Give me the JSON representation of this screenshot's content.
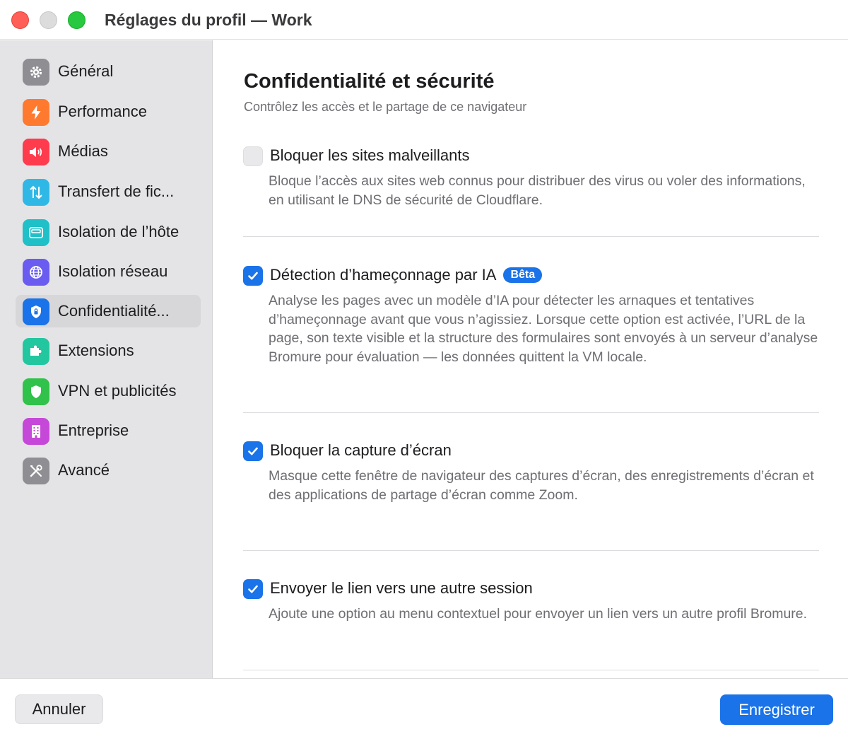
{
  "window": {
    "title": "Réglages du profil — Work"
  },
  "sidebar": {
    "items": [
      {
        "label": "Général",
        "icon": "gear-icon",
        "color": "#8e8e93"
      },
      {
        "label": "Performance",
        "icon": "bolt-icon",
        "color": "#ff7a2f"
      },
      {
        "label": "Médias",
        "icon": "speaker-icon",
        "color": "#ff3b4e"
      },
      {
        "label": "Transfert de fic...",
        "icon": "transfer-arrows-icon",
        "color": "#2fb8e6"
      },
      {
        "label": "Isolation de l’hôte",
        "icon": "window-icon",
        "color": "#20c0c8"
      },
      {
        "label": "Isolation réseau",
        "icon": "globe-icon",
        "color": "#6a5cf0"
      },
      {
        "label": "Confidentialité...",
        "icon": "shield-lock-icon",
        "color": "#1a73e8",
        "selected": true
      },
      {
        "label": "Extensions",
        "icon": "puzzle-icon",
        "color": "#22c7a0"
      },
      {
        "label": "VPN et publicités",
        "icon": "shield-icon",
        "color": "#30c24a"
      },
      {
        "label": "Entreprise",
        "icon": "building-icon",
        "color": "#c648d8"
      },
      {
        "label": "Avancé",
        "icon": "tools-icon",
        "color": "#8e8e93"
      }
    ]
  },
  "main": {
    "title": "Confidentialité et sécurité",
    "subtitle": "Contrôlez les accès et le partage de ce navigateur",
    "options": [
      {
        "title": "Bloquer les sites malveillants",
        "checked": false,
        "description": "Bloque l’accès aux sites web connus pour distribuer des virus ou voler des informations, en utilisant le DNS de sécurité de Cloudflare."
      },
      {
        "title": "Détection d’hameçonnage par IA",
        "checked": true,
        "badge": "Bêta",
        "description": "Analyse les pages avec un modèle d’IA pour détecter les arnaques et tentatives d’hameçonnage avant que vous n’agissiez. Lorsque cette option est activée, l’URL de la page, son texte visible et la structure des formulaires sont envoyés à un serveur d’analyse Bromure pour évaluation — les données quittent la VM locale."
      },
      {
        "title": "Bloquer la capture d’écran",
        "checked": true,
        "description": "Masque cette fenêtre de navigateur des captures d’écran, des enregistrements d’écran et des applications de partage d’écran comme Zoom."
      },
      {
        "title": "Envoyer le lien vers une autre session",
        "checked": true,
        "description": "Ajoute une option au menu contextuel pour envoyer un lien vers un autre profil Bromure."
      }
    ]
  },
  "footer": {
    "cancel_label": "Annuler",
    "save_label": "Enregistrer"
  },
  "colors": {
    "accent": "#1a73e8",
    "sidebar_bg": "#e4e4e6"
  }
}
